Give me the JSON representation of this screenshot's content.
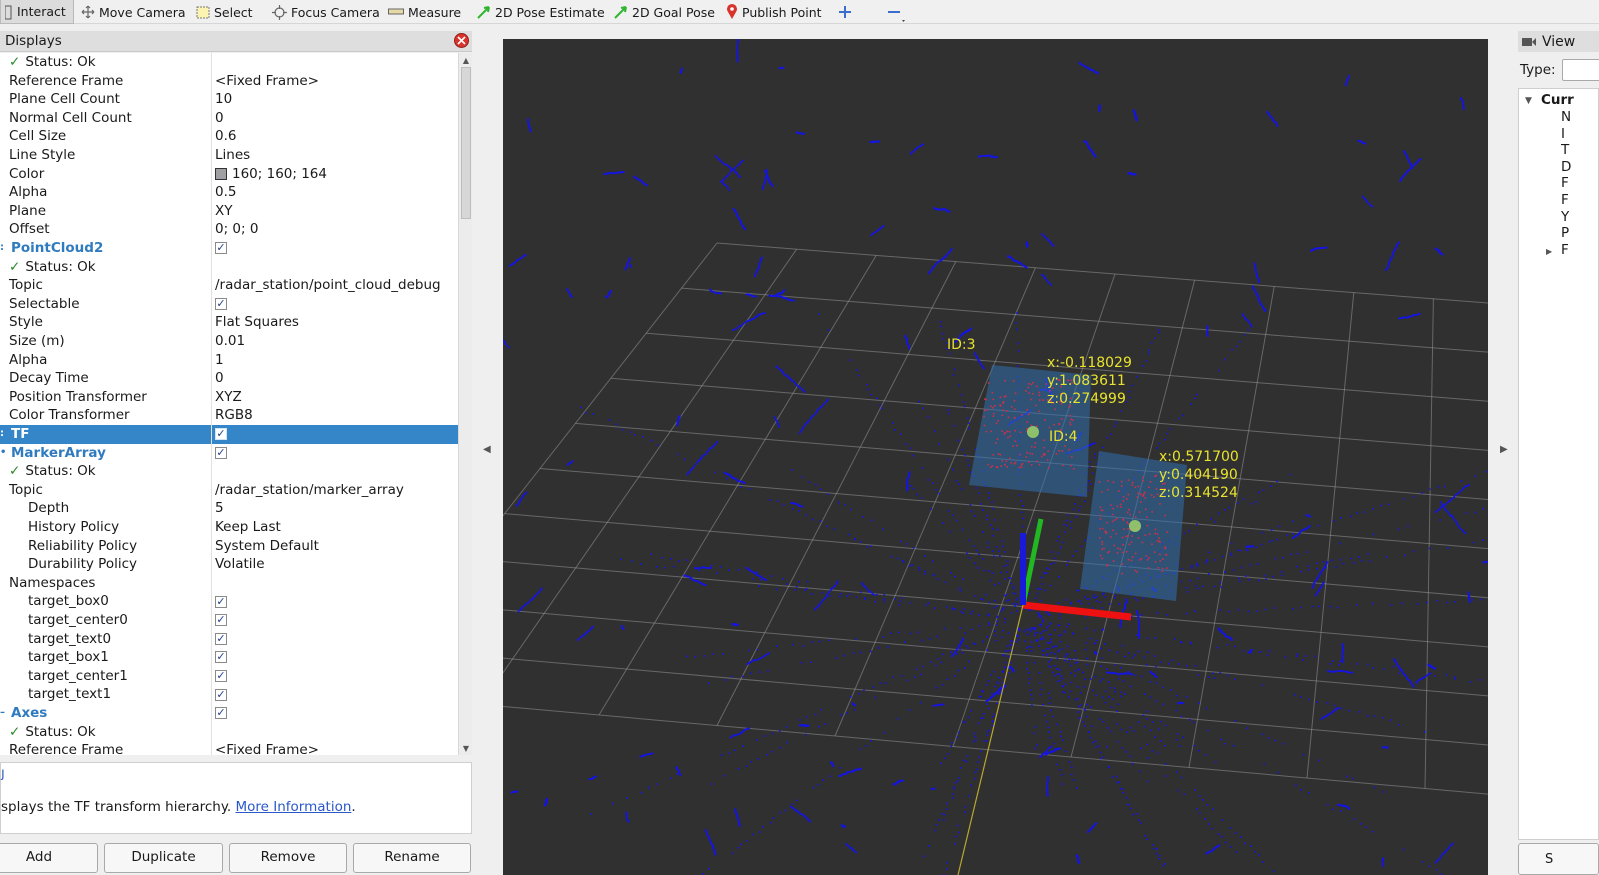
{
  "toolbar": {
    "tools": [
      {
        "label": "Interact",
        "icon": "interact-icon",
        "active": true
      },
      {
        "label": "Move Camera",
        "icon": "move-camera-icon"
      },
      {
        "label": "Select",
        "icon": "select-icon"
      },
      {
        "label": "Focus Camera",
        "icon": "focus-camera-icon"
      },
      {
        "label": "Measure",
        "icon": "measure-icon"
      },
      {
        "label": "2D Pose Estimate",
        "icon": "pose-arrow-icon",
        "color": "#2fb52f"
      },
      {
        "label": "2D Goal Pose",
        "icon": "goal-arrow-icon",
        "color": "#2fb52f"
      },
      {
        "label": "Publish Point",
        "icon": "map-pin-icon",
        "color": "#d9342b"
      }
    ]
  },
  "displays": {
    "title": "Displays",
    "rows": [
      {
        "label": "Status: Ok",
        "ok": true,
        "indent": 9
      },
      {
        "label": "Reference Frame",
        "value": "<Fixed Frame>",
        "indent": 9
      },
      {
        "label": "Plane Cell Count",
        "value": "10",
        "indent": 9
      },
      {
        "label": "Normal Cell Count",
        "value": "0",
        "indent": 9
      },
      {
        "label": "Cell Size",
        "value": "0.6",
        "indent": 9
      },
      {
        "label": "Line Style",
        "value": "Lines",
        "indent": 9
      },
      {
        "label": "Color",
        "value": "160; 160; 164",
        "swatch": "#a0a0a4",
        "indent": 9
      },
      {
        "label": "Alpha",
        "value": "0.5",
        "indent": 9
      },
      {
        "label": "Plane",
        "value": "XY",
        "indent": 9
      },
      {
        "label": "Offset",
        "value": "0; 0; 0",
        "indent": 9
      },
      {
        "label": "PointCloud2",
        "checked": true,
        "category": true,
        "indent": 11
      },
      {
        "label": "Status: Ok",
        "ok": true,
        "indent": 9
      },
      {
        "label": "Topic",
        "value": "/radar_station/point_cloud_debug",
        "indent": 9
      },
      {
        "label": "Selectable",
        "checked": true,
        "indent": 9
      },
      {
        "label": "Style",
        "value": "Flat Squares",
        "indent": 9
      },
      {
        "label": "Size (m)",
        "value": "0.01",
        "indent": 9
      },
      {
        "label": "Alpha",
        "value": "1",
        "indent": 9
      },
      {
        "label": "Decay Time",
        "value": "0",
        "indent": 9
      },
      {
        "label": "Position Transformer",
        "value": "XYZ",
        "indent": 9
      },
      {
        "label": "Color Transformer",
        "value": "RGB8",
        "indent": 9
      },
      {
        "label": "TF",
        "checked": true,
        "category": true,
        "selected": true,
        "indent": 11
      },
      {
        "label": "MarkerArray",
        "checked": true,
        "category": true,
        "indent": 11
      },
      {
        "label": "Status: Ok",
        "ok": true,
        "indent": 9
      },
      {
        "label": "Topic",
        "value": "/radar_station/marker_array",
        "indent": 9
      },
      {
        "label": "Depth",
        "value": "5",
        "indent": 28
      },
      {
        "label": "History Policy",
        "value": "Keep Last",
        "indent": 28
      },
      {
        "label": "Reliability Policy",
        "value": "System Default",
        "indent": 28
      },
      {
        "label": "Durability Policy",
        "value": "Volatile",
        "indent": 28
      },
      {
        "label": "Namespaces",
        "indent": 9
      },
      {
        "label": "target_box0",
        "checked": true,
        "indent": 28
      },
      {
        "label": "target_center0",
        "checked": true,
        "indent": 28
      },
      {
        "label": "target_text0",
        "checked": true,
        "indent": 28
      },
      {
        "label": "target_box1",
        "checked": true,
        "indent": 28
      },
      {
        "label": "target_center1",
        "checked": true,
        "indent": 28
      },
      {
        "label": "target_text1",
        "checked": true,
        "indent": 28
      },
      {
        "label": "Axes",
        "checked": true,
        "category": true,
        "indent": 11
      },
      {
        "label": "Status: Ok",
        "ok": true,
        "indent": 9
      },
      {
        "label": "Reference Frame",
        "value": "<Fixed Frame>",
        "indent": 9
      }
    ],
    "description_text": "splays the TF transform hierarchy. ",
    "description_link": "More Information",
    "description_end": ".",
    "buttons": [
      "Add",
      "Duplicate",
      "Remove",
      "Rename"
    ]
  },
  "viewport": {
    "labels": {
      "id3": "ID:3",
      "id4": "ID:4",
      "coords_a": "x:-0.118029\ny:1.083611\nz:0.274999",
      "coords_b": "x:0.571700\ny:0.404190\nz:0.314524"
    },
    "colors": {
      "background": "#303030",
      "grid": "#a0a0a4",
      "points": "#1414e6",
      "target_points": "#d0304a",
      "box": "#2f6fae",
      "label": "#e9e32d"
    }
  },
  "views": {
    "title": "View",
    "type_label": "Type:",
    "tree_root": "Curr",
    "tree_items": [
      "N",
      "I",
      "T",
      "D",
      "F",
      "F",
      "Y",
      "P",
      "F"
    ],
    "button_label": "S"
  }
}
